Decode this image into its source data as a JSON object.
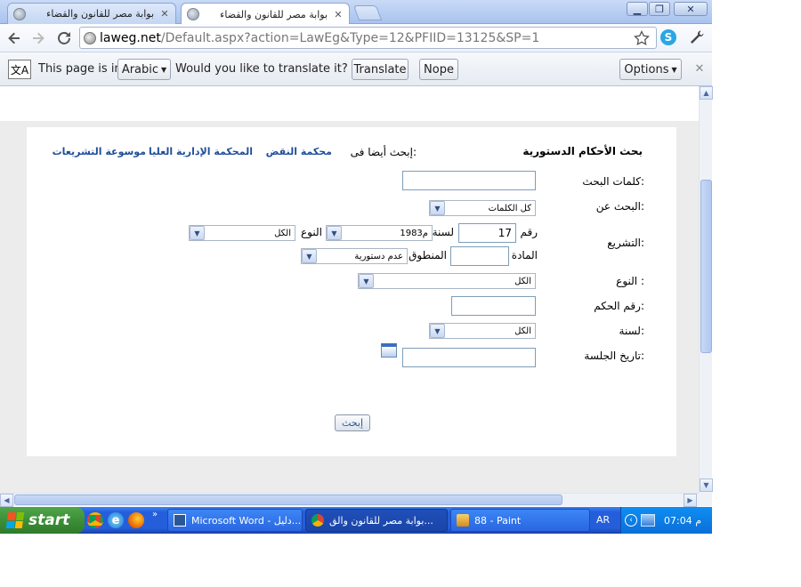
{
  "browser": {
    "tabs": [
      {
        "title": "بوابة مصر للقانون والقضاء",
        "active": false
      },
      {
        "title": "بوابة مصر للقانون والقضاء",
        "active": true
      }
    ],
    "window_buttons": {
      "minimize": "▁",
      "restore": "❐",
      "close": "✕"
    },
    "url_host": "laweg.net",
    "url_rest": "/Default.aspx?action=LawEg&Type=12&PFIID=13125&SP=1",
    "icons": [
      "back-icon",
      "forward-icon",
      "reload-icon",
      "star-icon",
      "skype-icon",
      "wrench-icon"
    ]
  },
  "translate_bar": {
    "prefix": "This page is in",
    "language": "Arabic",
    "question": "Would you like to translate it?",
    "translate_label": "Translate",
    "nope_label": "Nope",
    "options_label": "Options",
    "close": "✕"
  },
  "page": {
    "heading": "بحث الأحكام الدستورية",
    "also_search_in": "إبحث أيضا فى:",
    "links": [
      "محكمة النقض",
      "المحكمة الإدارية العليا",
      "موسوعة التشريعات"
    ],
    "keywords_label": "كلمات البحث:",
    "search_for_label": "البحث عن:",
    "search_for_value": "كل الكلمات",
    "legislation_label": "التشريع:",
    "number_label": "رقم",
    "number_value": "17",
    "year_label": "لسنة",
    "year_value": "1983م",
    "type_inline_label": "النوع",
    "type_inline_value": "الكل",
    "article_label": "المادة",
    "pronouncement_label": "المنطوق",
    "pronouncement_value": "عدم دستورية",
    "type_label": "النوع :",
    "type_value": "الكل",
    "ruling_number_label": "رقم الحكم:",
    "year2_label": "لسنة:",
    "year2_value": "الكل",
    "session_date_label": "تاريخ الجلسة:",
    "search_button": "إبحث"
  },
  "taskbar": {
    "start_label": "start",
    "items": [
      {
        "label": "Microsoft Word - دليل...",
        "active": false
      },
      {
        "label": "بوابة مصر للقانون والق...",
        "active": true
      },
      {
        "label": "88 - Paint",
        "active": false
      }
    ],
    "language": "AR",
    "clock": "07:04 م"
  }
}
